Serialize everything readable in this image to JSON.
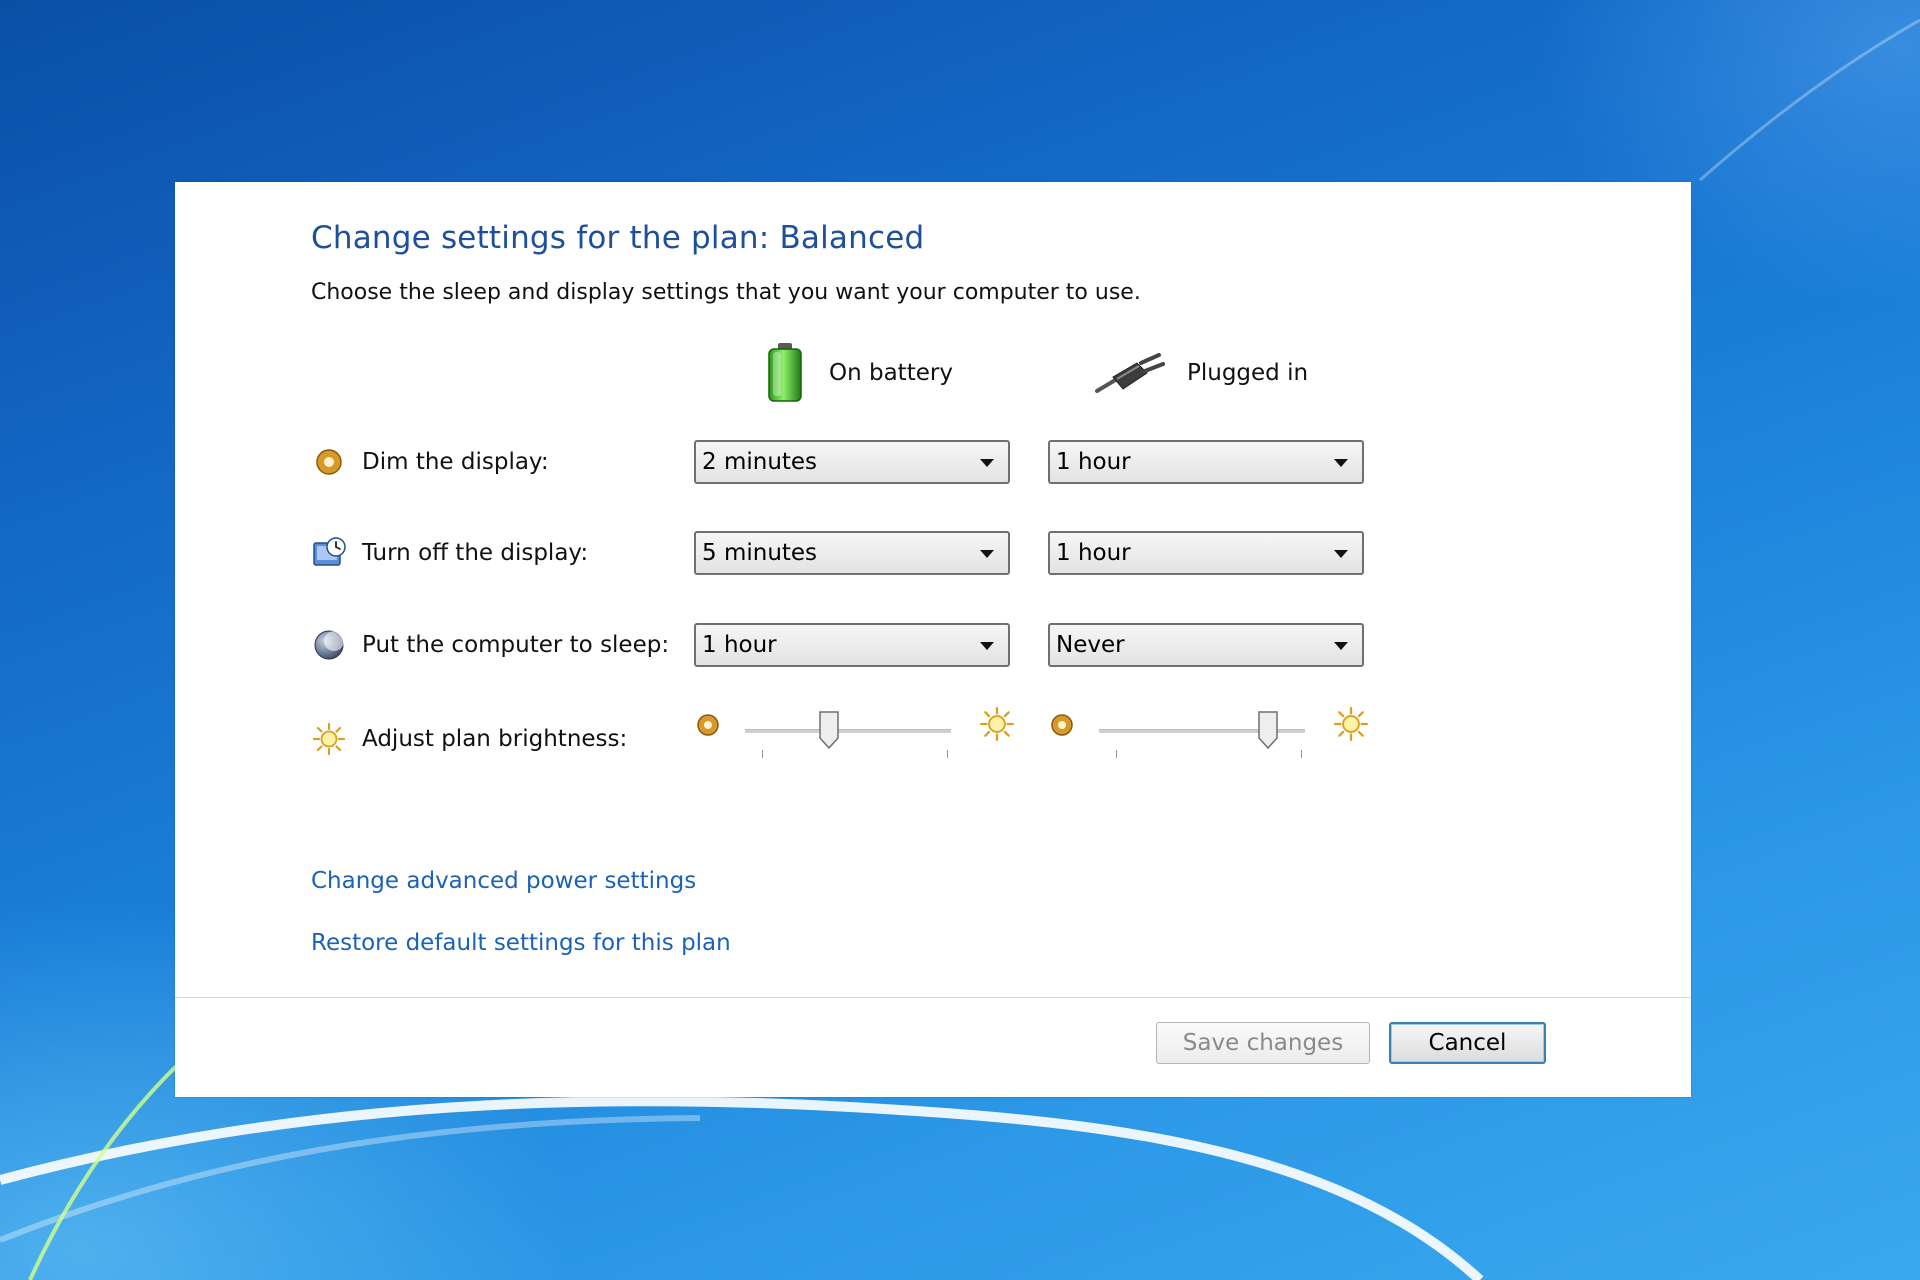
{
  "dialog": {
    "title": "Change settings for the plan: Balanced",
    "subtitle": "Choose the sleep and display settings that you want your computer to use."
  },
  "columns": {
    "battery": {
      "label": "On battery",
      "icon": "battery-icon"
    },
    "plugged": {
      "label": "Plugged in",
      "icon": "power-plug-icon"
    }
  },
  "rows": [
    {
      "label": "Dim the display:",
      "icon": "dim-display-icon",
      "battery": "2 minutes",
      "plugged": "1 hour"
    },
    {
      "label": "Turn off the display:",
      "icon": "monitor-clock-icon",
      "battery": "5 minutes",
      "plugged": "1 hour"
    },
    {
      "label": "Put the computer to sleep:",
      "icon": "moon-sleep-icon",
      "battery": "1 hour",
      "plugged": "Never"
    }
  ],
  "brightness": {
    "label": "Adjust plan brightness:",
    "icon": "sun-icon",
    "battery_level": 0.41,
    "plugged_level": 0.82
  },
  "links": {
    "advanced": "Change advanced power settings",
    "restore": "Restore default settings for this plan"
  },
  "buttons": {
    "save": "Save changes",
    "cancel": "Cancel"
  },
  "colors": {
    "title": "#1e4f9c",
    "link": "#1a62b8",
    "desktop": "#1a7fd9"
  }
}
